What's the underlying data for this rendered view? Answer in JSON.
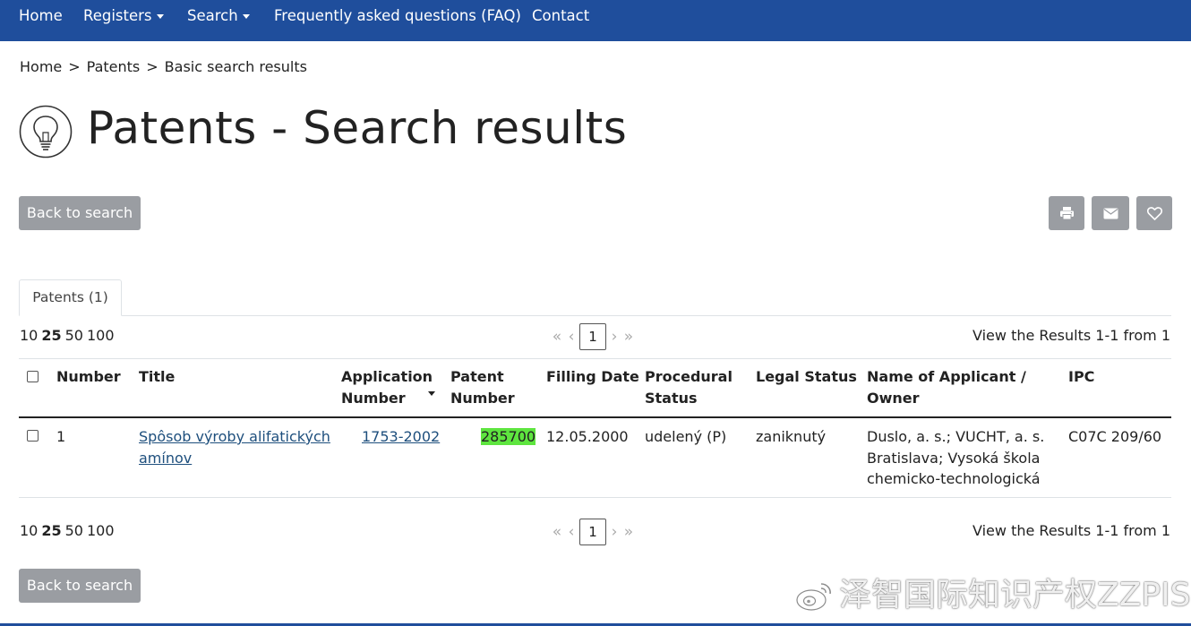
{
  "nav": {
    "home": "Home",
    "registers": "Registers",
    "search": "Search",
    "faq": "Frequently asked questions (FAQ)",
    "contact": "Contact"
  },
  "breadcrumb": {
    "home": "Home",
    "patents": "Patents",
    "current": "Basic search results",
    "separator": ">"
  },
  "page_title": "Patents - Search results",
  "buttons": {
    "back_to_search": "Back to search",
    "print_icon": "print-icon",
    "email_icon": "envelope-icon",
    "favorite_icon": "heart-icon"
  },
  "tabs": [
    {
      "label": "Patents (1)"
    }
  ],
  "pagination": {
    "per_page": [
      "10",
      "25",
      "50",
      "100"
    ],
    "per_page_active": "25",
    "first": "«",
    "prev": "‹",
    "current_page": "1",
    "next": "›",
    "last": "»",
    "results_info": "View the Results 1-1 from 1"
  },
  "table": {
    "headers": {
      "number": "Number",
      "title": "Title",
      "application_number_1": "Application",
      "application_number_2": "Number",
      "patent_number_1": "Patent",
      "patent_number_2": "Number",
      "filling_date": "Filling Date",
      "procedural_status_1": "Procedural",
      "procedural_status_2": "Status",
      "legal_status": "Legal Status",
      "applicant_1": "Name of Applicant /",
      "applicant_2": "Owner",
      "ipc": "IPC"
    },
    "rows": [
      {
        "number": "1",
        "title_1": "Spôsob výroby alifatických",
        "title_2": "amínov",
        "application_number": "1753-2002",
        "patent_number": "285700",
        "filling_date": "12.05.2000",
        "procedural_status": "udelený (P)",
        "legal_status": "zaniknutý",
        "applicant_1": "Duslo, a. s.; VUCHT, a. s.",
        "applicant_2": "Bratislava; Vysoká škola",
        "applicant_3": "chemicko-technologická",
        "ipc": "C07C 209/60"
      }
    ]
  },
  "watermark": "泽智国际知识产权ZZPIS",
  "colors": {
    "navbar": "#1f4e9c",
    "button_grey": "#9a9da2",
    "link": "#1e4f7d",
    "highlight": "#5ee53f"
  }
}
